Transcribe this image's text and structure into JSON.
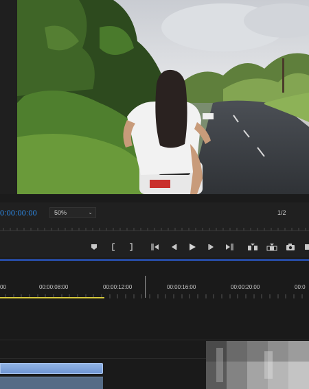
{
  "monitor": {
    "timecode": "0:00:00:00",
    "zoom": "50%",
    "resolution": "1/2"
  },
  "transport": {
    "buttons": [
      "add-marker",
      "mark-in",
      "mark-out",
      "go-to-in",
      "step-back",
      "play",
      "step-forward",
      "go-to-out",
      "insert",
      "overwrite",
      "export-frame"
    ]
  },
  "timeline": {
    "ruler_labels": [
      "00",
      "00:00:08:00",
      "00:00:12:00",
      "00:00:16:00",
      "00:00:20:00",
      "00:0"
    ]
  },
  "colors": {
    "timecode": "#2d8ceb",
    "work_area": "#d6c93c",
    "clip": "#7fa4db",
    "playhead_line": "#2a58c9"
  }
}
